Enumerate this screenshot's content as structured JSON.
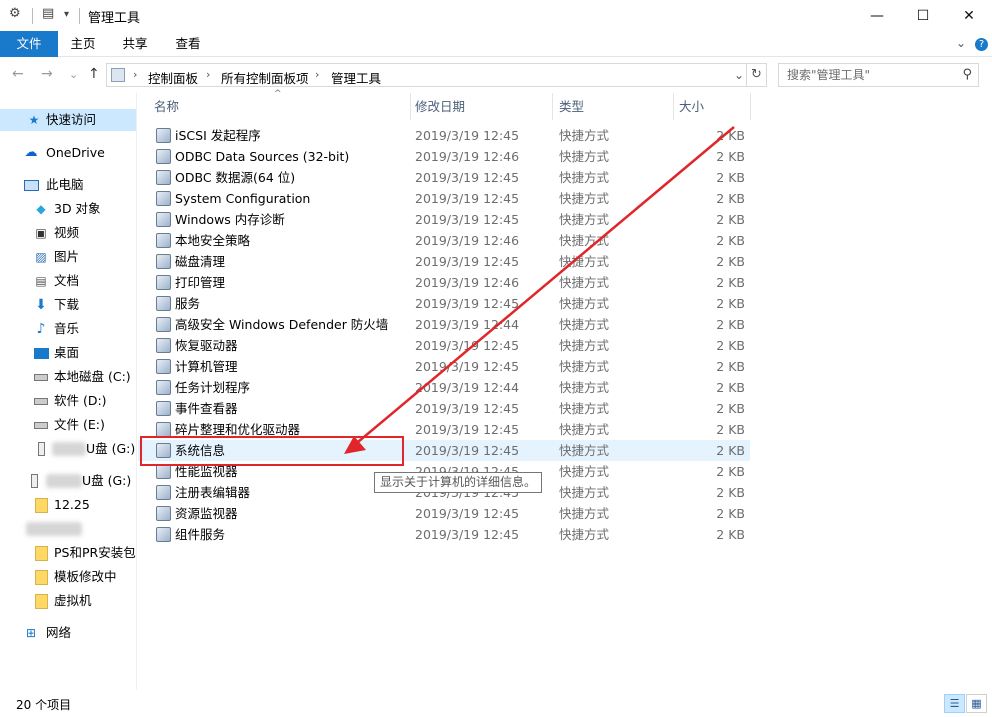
{
  "window": {
    "title": "管理工具",
    "minimize_glyph": "—",
    "maximize_glyph": "☐",
    "close_glyph": "✕"
  },
  "ribbon": {
    "tabs": [
      "文件",
      "主页",
      "共享",
      "查看"
    ],
    "expand_glyph": "⌄",
    "help_glyph": "?"
  },
  "nav": {
    "back_glyph": "←",
    "forward_glyph": "→",
    "recent_glyph": "⌄",
    "up_glyph": "↑",
    "breadcrumb": [
      "控制面板",
      "所有控制面板项",
      "管理工具"
    ],
    "dropdown_glyph": "⌄",
    "refresh_glyph": "↻",
    "search_placeholder": "搜索\"管理工具\"",
    "search_glyph": "⚲"
  },
  "sidebar": {
    "quick_access": "快速访问",
    "onedrive": "OneDrive",
    "this_pc": "此电脑",
    "items": [
      {
        "label": "3D 对象",
        "icon": "3d-objects-icon"
      },
      {
        "label": "视频",
        "icon": "video-icon"
      },
      {
        "label": "图片",
        "icon": "pictures-icon"
      },
      {
        "label": "文档",
        "icon": "documents-icon"
      },
      {
        "label": "下载",
        "icon": "download-icon"
      },
      {
        "label": "音乐",
        "icon": "music-icon"
      },
      {
        "label": "桌面",
        "icon": "desktop-icon"
      },
      {
        "label": "本地磁盘 (C:)",
        "icon": "drive-icon"
      },
      {
        "label": "软件 (D:)",
        "icon": "drive-icon"
      },
      {
        "label": "文件 (E:)",
        "icon": "drive-icon"
      },
      {
        "label": "U盘 (G:)",
        "icon": "usb-drive-icon"
      }
    ],
    "usb_root": "U盘 (G:)",
    "usb_folders": [
      "12.25",
      "PS和PR安装包",
      "模板修改中",
      "虚拟机"
    ],
    "network": "网络"
  },
  "columns": {
    "name": "名称",
    "date": "修改日期",
    "type": "类型",
    "size": "大小"
  },
  "files": [
    {
      "name": "iSCSI 发起程序",
      "date": "2019/3/19 12:45",
      "type": "快捷方式",
      "size": "2 KB"
    },
    {
      "name": "ODBC Data Sources (32-bit)",
      "date": "2019/3/19 12:46",
      "type": "快捷方式",
      "size": "2 KB"
    },
    {
      "name": "ODBC 数据源(64 位)",
      "date": "2019/3/19 12:45",
      "type": "快捷方式",
      "size": "2 KB"
    },
    {
      "name": "System Configuration",
      "date": "2019/3/19 12:45",
      "type": "快捷方式",
      "size": "2 KB"
    },
    {
      "name": "Windows 内存诊断",
      "date": "2019/3/19 12:45",
      "type": "快捷方式",
      "size": "2 KB"
    },
    {
      "name": "本地安全策略",
      "date": "2019/3/19 12:46",
      "type": "快捷方式",
      "size": "2 KB"
    },
    {
      "name": "磁盘清理",
      "date": "2019/3/19 12:45",
      "type": "快捷方式",
      "size": "2 KB"
    },
    {
      "name": "打印管理",
      "date": "2019/3/19 12:46",
      "type": "快捷方式",
      "size": "2 KB"
    },
    {
      "name": "服务",
      "date": "2019/3/19 12:45",
      "type": "快捷方式",
      "size": "2 KB"
    },
    {
      "name": "高级安全 Windows Defender 防火墙",
      "date": "2019/3/19 12:44",
      "type": "快捷方式",
      "size": "2 KB"
    },
    {
      "name": "恢复驱动器",
      "date": "2019/3/19 12:45",
      "type": "快捷方式",
      "size": "2 KB"
    },
    {
      "name": "计算机管理",
      "date": "2019/3/19 12:45",
      "type": "快捷方式",
      "size": "2 KB"
    },
    {
      "name": "任务计划程序",
      "date": "2019/3/19 12:44",
      "type": "快捷方式",
      "size": "2 KB"
    },
    {
      "name": "事件查看器",
      "date": "2019/3/19 12:45",
      "type": "快捷方式",
      "size": "2 KB"
    },
    {
      "name": "碎片整理和优化驱动器",
      "date": "2019/3/19 12:45",
      "type": "快捷方式",
      "size": "2 KB"
    },
    {
      "name": "系统信息",
      "date": "2019/3/19 12:45",
      "type": "快捷方式",
      "size": "2 KB"
    },
    {
      "name": "性能监视器",
      "date": "2019/3/19 12:45",
      "type": "快捷方式",
      "size": "2 KB"
    },
    {
      "name": "注册表编辑器",
      "date": "2019/3/19 12:45",
      "type": "快捷方式",
      "size": "2 KB"
    },
    {
      "name": "资源监视器",
      "date": "2019/3/19 12:45",
      "type": "快捷方式",
      "size": "2 KB"
    },
    {
      "name": "组件服务",
      "date": "2019/3/19 12:45",
      "type": "快捷方式",
      "size": "2 KB"
    }
  ],
  "tooltip": "显示关于计算机的详细信息。",
  "status": {
    "item_count": "20 个项目"
  },
  "colors": {
    "accent": "#1979ca",
    "selection": "#cce8ff",
    "hover": "#e5f3ff",
    "annotation": "#e0262a"
  }
}
